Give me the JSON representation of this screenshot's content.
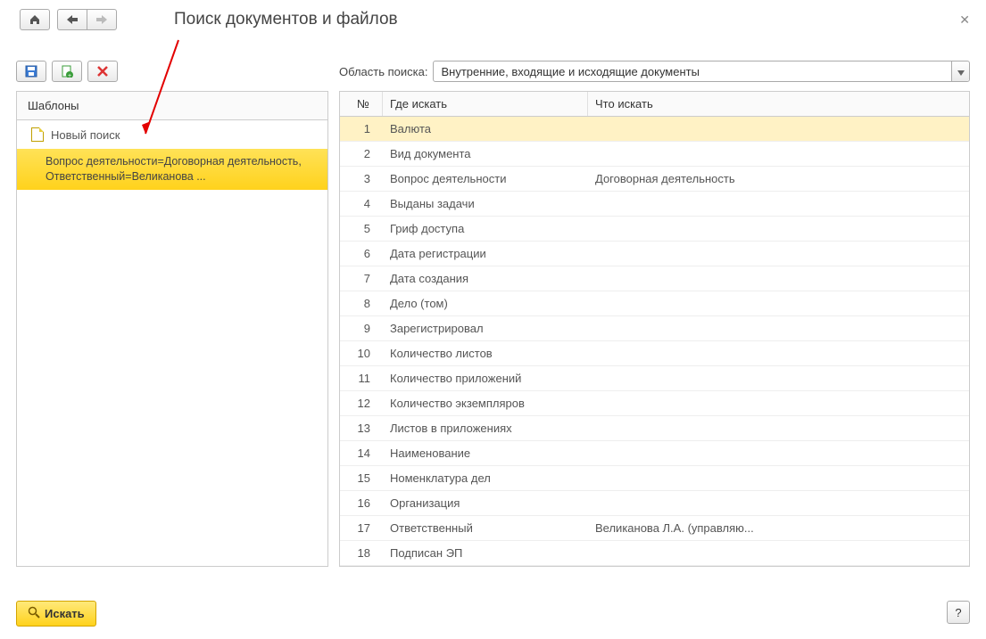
{
  "header": {
    "title": "Поиск документов и файлов"
  },
  "toolbar": {
    "save": "Сохранить",
    "new": "Новый",
    "delete": "Удалить"
  },
  "search_scope": {
    "label": "Область поиска:",
    "value": "Внутренние, входящие и исходящие документы"
  },
  "templates": {
    "header": "Шаблоны",
    "new_search": "Новый поиск",
    "selected": "Вопрос деятельности=Договорная деятельность, Ответственный=Великанова ..."
  },
  "criteria": {
    "col_num": "№",
    "col_where": "Где искать",
    "col_what": "Что искать",
    "rows": [
      {
        "n": "1",
        "where": "Валюта",
        "what": ""
      },
      {
        "n": "2",
        "where": "Вид документа",
        "what": ""
      },
      {
        "n": "3",
        "where": "Вопрос деятельности",
        "what": "Договорная деятельность"
      },
      {
        "n": "4",
        "where": "Выданы задачи",
        "what": ""
      },
      {
        "n": "5",
        "where": "Гриф доступа",
        "what": ""
      },
      {
        "n": "6",
        "where": "Дата регистрации",
        "what": ""
      },
      {
        "n": "7",
        "where": "Дата создания",
        "what": ""
      },
      {
        "n": "8",
        "where": "Дело (том)",
        "what": ""
      },
      {
        "n": "9",
        "where": "Зарегистрировал",
        "what": ""
      },
      {
        "n": "10",
        "where": "Количество листов",
        "what": ""
      },
      {
        "n": "11",
        "where": "Количество приложений",
        "what": ""
      },
      {
        "n": "12",
        "where": "Количество экземпляров",
        "what": ""
      },
      {
        "n": "13",
        "where": "Листов в приложениях",
        "what": ""
      },
      {
        "n": "14",
        "where": "Наименование",
        "what": ""
      },
      {
        "n": "15",
        "where": "Номенклатура дел",
        "what": ""
      },
      {
        "n": "16",
        "where": "Организация",
        "what": ""
      },
      {
        "n": "17",
        "where": "Ответственный",
        "what": "Великанова Л.А. (управляю..."
      },
      {
        "n": "18",
        "where": "Подписан ЭП",
        "what": ""
      }
    ]
  },
  "footer": {
    "search": "Искать",
    "help": "?"
  }
}
